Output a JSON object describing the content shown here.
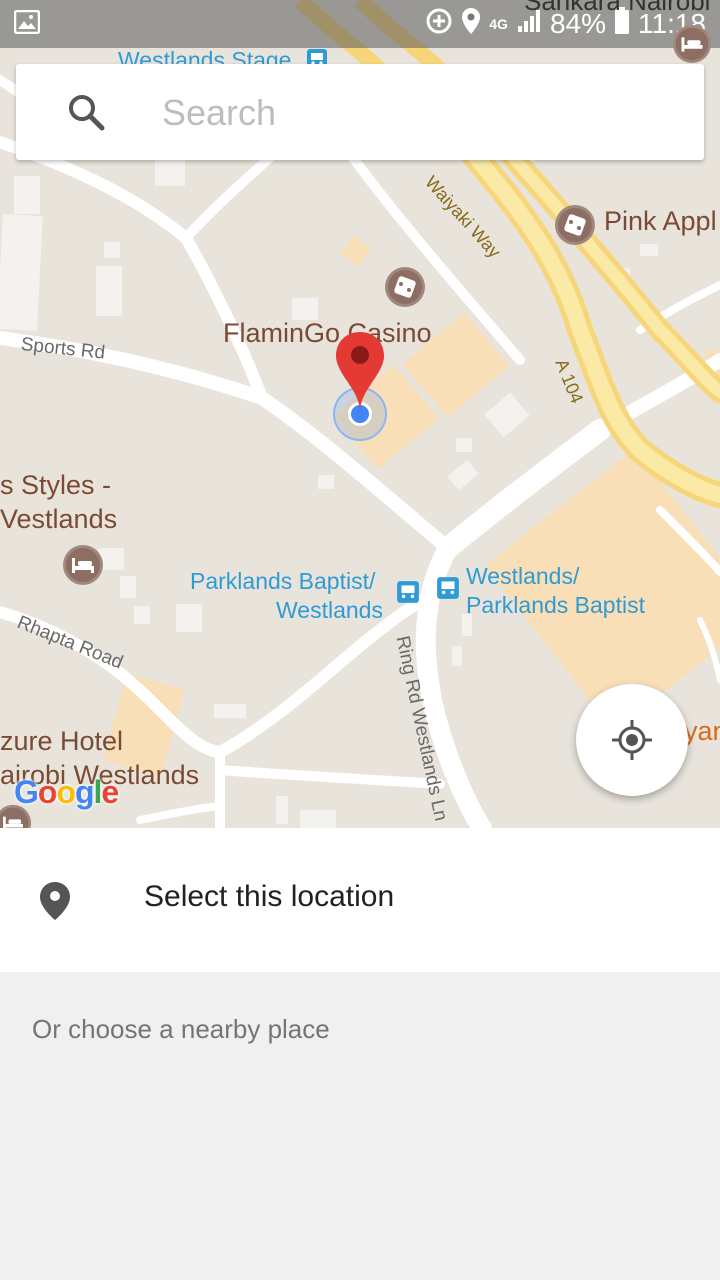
{
  "status_bar": {
    "network": "4G",
    "battery": "84%",
    "time": "11:18",
    "overlay_text": "Sankara Nairobi"
  },
  "search": {
    "placeholder": "Search"
  },
  "map": {
    "places": {
      "westlands_stage": "Westlands Stage",
      "pink_apple": "Pink Appl",
      "flamingo_casino": "FlaminGo Casino",
      "styles_line1": "s Styles -",
      "styles_line2": "Vestlands",
      "parklands_baptist_left_1": "Parklands Baptist/",
      "parklands_baptist_left_2": "Westlands",
      "westlands_right_1": "Westlands/",
      "westlands_right_2": "Parklands Baptist",
      "azure_line1": "zure Hotel",
      "azure_line2": "airobi Westlands",
      "edge_right": "yan"
    },
    "roads": {
      "sports_rd": "Sports Rd",
      "waiyaki_way": "Waiyaki Way",
      "a104": "A 104",
      "rhapta_road": "Rhapta Road",
      "ring_rd": "Ring Rd Westlands Ln"
    },
    "google_logo": [
      "G",
      "o",
      "o",
      "g",
      "l",
      "e"
    ],
    "google_colors": [
      "#4285f4",
      "#ea4335",
      "#fbbc05",
      "#4285f4",
      "#34a853",
      "#ea4335"
    ]
  },
  "select_location": {
    "label": "Select this location"
  },
  "nearby": {
    "label": "Or choose a nearby place"
  },
  "colors": {
    "marker": "#e53935",
    "my_location": "#4285f4",
    "transit": "#2f9bd6",
    "poi": "#7a4a33"
  }
}
